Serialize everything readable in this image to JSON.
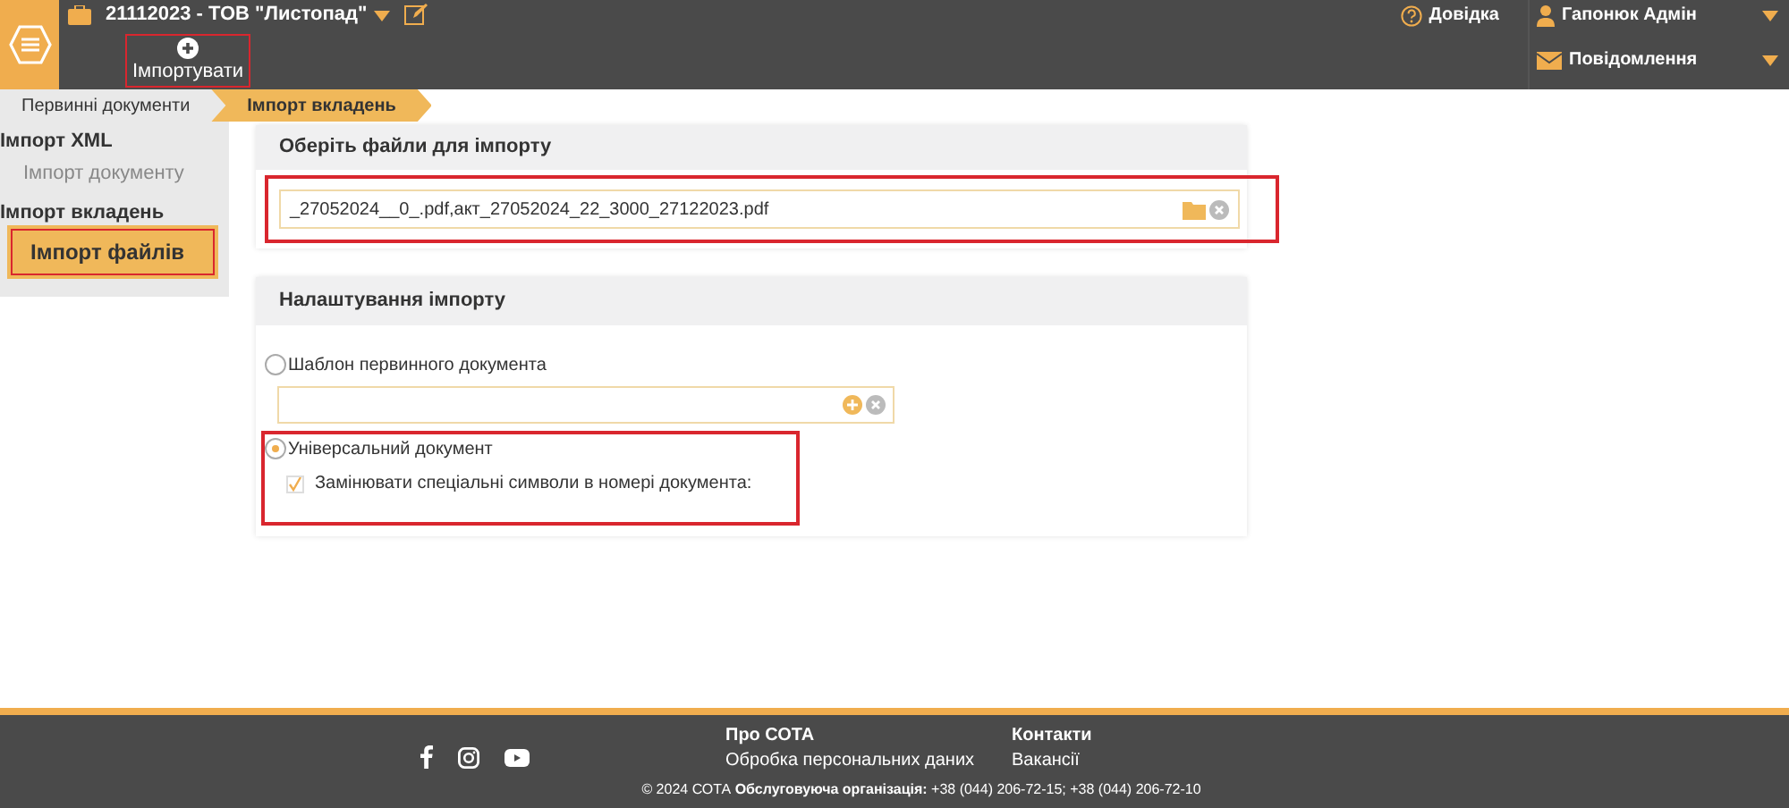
{
  "header": {
    "organization": "21112023 - ТОВ \"Листопад\"",
    "help": "Довідка",
    "user": "Гапонюк Адмін",
    "messages": "Повідомлення",
    "toolbar": [
      {
        "label": "Імпортувати",
        "highlighted": true
      }
    ]
  },
  "breadcrumbs": [
    {
      "label": "Первинні документи",
      "selected": false
    },
    {
      "label": "Імпорт вкладень",
      "selected": true
    }
  ],
  "sidebar": [
    {
      "label": "Імпорт XML",
      "children": [
        {
          "label": "Імпорт документу",
          "selected": false,
          "highlighted": false
        }
      ]
    },
    {
      "label": "Імпорт вкладень",
      "children": [
        {
          "label": "Імпорт файлів",
          "selected": true,
          "highlighted": true
        }
      ]
    }
  ],
  "files_panel": {
    "title": "Оберіть файли для імпорту",
    "value": "_27052024__0_.pdf,акт_27052024_22_3000_27122023.pdf",
    "highlighted": true
  },
  "settings_panel": {
    "title": "Налаштування імпорту",
    "options": [
      {
        "label": "Шаблон первинного документа",
        "selected": false,
        "highlighted": false,
        "has_field": true
      },
      {
        "label": "Універсальний документ",
        "selected": true,
        "highlighted": true,
        "checkbox": {
          "label": "Замінювати спеціальні символи в номері документа:",
          "checked": true
        }
      }
    ]
  },
  "footer": {
    "links": [
      [
        "Про СОТА",
        "Обробка персональних даних"
      ],
      [
        "Контакти",
        "Вакансії"
      ]
    ],
    "copyright": "© 2024 СОТА **Обслуговуюча організація:** +38 (044) 206-72-15; +38 (044) 206-72-10"
  }
}
